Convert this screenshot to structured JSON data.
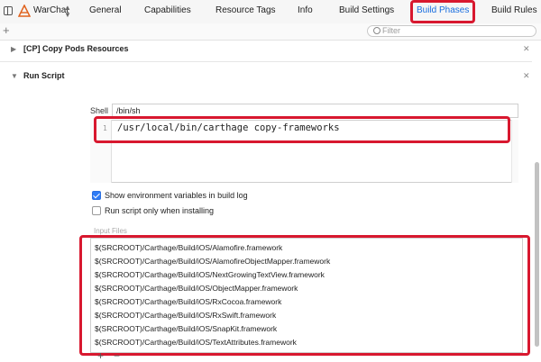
{
  "toolbar": {
    "target_name": "WarChat",
    "tabs": {
      "general": "General",
      "capabilities": "Capabilities",
      "resource_tags": "Resource Tags",
      "info": "Info",
      "build_settings": "Build Settings",
      "build_phases": "Build Phases",
      "build_rules": "Build Rules"
    },
    "active_tab": "Build Phases",
    "active_color": "#1a6fe0"
  },
  "filter": {
    "placeholder": "Filter"
  },
  "phases": {
    "copy_pods": {
      "title": "[CP] Copy Pods Resources",
      "expanded": false
    },
    "run_script": {
      "title": "Run Script",
      "expanded": true,
      "shell_label": "Shell",
      "shell_value": "/bin/sh",
      "script_lines": [
        {
          "number": "1",
          "text": "/usr/local/bin/carthage copy-frameworks"
        }
      ],
      "show_env_label": "Show environment variables in build log",
      "show_env_checked": true,
      "run_only_installing_label": "Run script only when installing",
      "run_only_installing_checked": false,
      "input_files_label": "Input Files",
      "input_files": [
        "$(SRCROOT)/Carthage/Build/iOS/Alamofire.framework",
        "$(SRCROOT)/Carthage/Build/iOS/AlamofireObjectMapper.framework",
        "$(SRCROOT)/Carthage/Build/iOS/NextGrowingTextView.framework",
        "$(SRCROOT)/Carthage/Build/iOS/ObjectMapper.framework",
        "$(SRCROOT)/Carthage/Build/iOS/RxCocoa.framework",
        "$(SRCROOT)/Carthage/Build/iOS/RxSwift.framework",
        "$(SRCROOT)/Carthage/Build/iOS/SnapKit.framework",
        "$(SRCROOT)/Carthage/Build/iOS/TextAttributes.framework"
      ]
    }
  },
  "highlight_color": "#d8182f",
  "checkbox_color": "#2f7cf6"
}
